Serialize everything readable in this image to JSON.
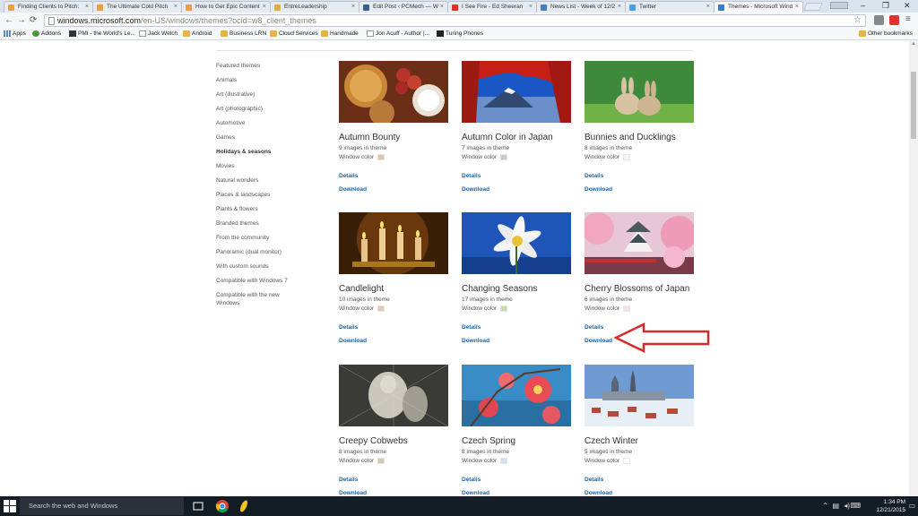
{
  "browser": {
    "tabs": [
      {
        "title": "Finding Clients to Pitch: ",
        "color": "#e8a23b"
      },
      {
        "title": "The Ultimate Cold Pitch",
        "color": "#e8a23b"
      },
      {
        "title": "How to Get Epic Content",
        "color": "#e8a23b"
      },
      {
        "title": "EntreLeadership",
        "color": "#d9b13a"
      },
      {
        "title": "Edit Post ‹ PCMech — W",
        "color": "#3b5f8f"
      },
      {
        "title": "I See Fire - Ed Sheeran",
        "color": "#e52d27"
      },
      {
        "title": "News List - Week of 12/2",
        "color": "#4a7ebb"
      },
      {
        "title": "Twitter",
        "color": "#4a9fe8"
      },
      {
        "title": "Themes - Microsoft Wind",
        "color": "#2f7fd1"
      }
    ],
    "url_domain": "windows.microsoft.com",
    "url_path": "/en-US/windows/themes?ocid=w8_client_themes",
    "bookmarks": [
      {
        "label": "Apps",
        "type": "apps"
      },
      {
        "label": "Addons",
        "type": "green"
      },
      {
        "label": "PMI - the World's Le...",
        "type": "pmi"
      },
      {
        "label": "Jack Welch",
        "type": "page"
      },
      {
        "label": "Android",
        "type": "folder"
      },
      {
        "label": "Business LRN",
        "type": "folder"
      },
      {
        "label": "Cloud Services",
        "type": "folder"
      },
      {
        "label": "Handmade",
        "type": "folder"
      },
      {
        "label": "Jon Acuff - Author |...",
        "type": "page"
      },
      {
        "label": "Turing Phones",
        "type": "turing"
      }
    ],
    "other_bookmarks": "Other bookmarks"
  },
  "sidebar": {
    "items": [
      {
        "label": "Featured themes",
        "active": false
      },
      {
        "label": "Animals",
        "active": false
      },
      {
        "label": "Art (illustrative)",
        "active": false
      },
      {
        "label": "Art (photographic)",
        "active": false
      },
      {
        "label": "Automotive",
        "active": false
      },
      {
        "label": "Games",
        "active": false
      },
      {
        "label": "Holidays & seasons",
        "active": true
      },
      {
        "label": "Movies",
        "active": false
      },
      {
        "label": "Natural wonders",
        "active": false
      },
      {
        "label": "Places & landscapes",
        "active": false
      },
      {
        "label": "Plants & flowers",
        "active": false
      },
      {
        "label": "Branded themes",
        "active": false
      },
      {
        "label": "From the community",
        "active": false
      },
      {
        "label": "Panoramic (dual monitor)",
        "active": false
      },
      {
        "label": "With custom sounds",
        "active": false
      },
      {
        "label": "Compatible with Windows 7",
        "active": false
      },
      {
        "label": "Compatible with the new Windows",
        "active": false
      }
    ]
  },
  "labels": {
    "window_color": "Window color",
    "details": "Details",
    "download": "Download"
  },
  "themes": [
    {
      "title": "Autumn Bounty",
      "count": "9 images in theme",
      "swatch": "#dcc6a3",
      "thumb": "bounty"
    },
    {
      "title": "Autumn Color in Japan",
      "count": "7 images in theme",
      "swatch": "#c9c9c9",
      "thumb": "japan"
    },
    {
      "title": "Bunnies and Ducklings",
      "count": "8 images in theme",
      "swatch": "#f4f4f4",
      "thumb": "bunnies"
    },
    {
      "title": "Candlelight",
      "count": "10 images in theme",
      "swatch": "#d8ccb4",
      "thumb": "candle"
    },
    {
      "title": "Changing Seasons",
      "count": "17 images in theme",
      "swatch": "#c7dba8",
      "thumb": "flower"
    },
    {
      "title": "Cherry Blossoms of Japan",
      "count": "6 images in theme",
      "swatch": "#f4dff0",
      "thumb": "cherry"
    },
    {
      "title": "Creepy Cobwebs",
      "count": "8 images in theme",
      "swatch": "#d3cbb5",
      "thumb": "cobweb"
    },
    {
      "title": "Czech Spring",
      "count": "8 images in theme",
      "swatch": "#cfe0f4",
      "thumb": "spring"
    },
    {
      "title": "Czech Winter",
      "count": "5 images in theme",
      "swatch": "#ffffff",
      "thumb": "winter"
    }
  ],
  "taskbar": {
    "search_placeholder": "Search the web and Windows",
    "time": "1:34 PM",
    "date": "12/21/2015"
  },
  "colors": {
    "link": "#1a63a6",
    "annotation_arrow": "#d62b2b"
  }
}
